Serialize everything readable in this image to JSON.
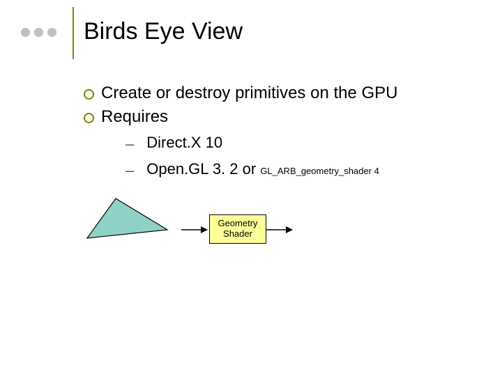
{
  "title": "Birds Eye View",
  "bullets": {
    "b1a": "Create or destroy primitives on the GPU",
    "b1b": "Requires",
    "b2a": "Direct.X 10",
    "b2b_main": "Open.GL 3. 2 or ",
    "b2b_ext": "GL_ARB_geometry_shader 4"
  },
  "diagram": {
    "box_line1": "Geometry",
    "box_line2": "Shader"
  }
}
